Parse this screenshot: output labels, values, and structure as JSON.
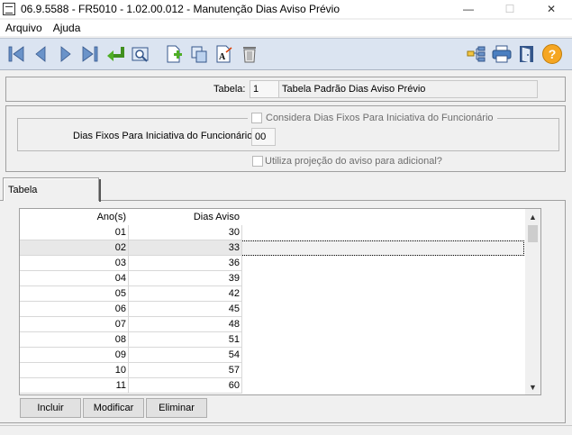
{
  "window": {
    "title": "06.9.5588 - FR5010 - 1.02.00.012 - Manutenção Dias Aviso Prévio",
    "minimize_glyph": "—",
    "maximize_glyph": "☐",
    "close_glyph": "✕"
  },
  "menu": {
    "items": [
      "Arquivo",
      "Ajuda"
    ]
  },
  "toolbar": {
    "icons": [
      "first-record-icon",
      "previous-record-icon",
      "next-record-icon",
      "last-record-icon",
      "return-icon",
      "preview-icon",
      "new-document-icon",
      "copy-icon",
      "edit-text-icon",
      "delete-icon",
      "structure-icon",
      "print-icon",
      "exit-icon",
      "help-icon"
    ],
    "help_glyph": "?",
    "accent_color": "#1e88e5"
  },
  "header": {
    "tabela_label": "Tabela:",
    "tabela_code": "1",
    "tabela_desc": "Tabela Padrão Dias Aviso Prévio"
  },
  "options": {
    "considera_label": "Considera Dias Fixos Para Iniciativa do Funcionário",
    "dias_fixos_label": "Dias Fixos Para Iniciativa do Funcionário:",
    "dias_fixos_value": "00",
    "projecao_label": "Utiliza projeção do aviso para adicional?"
  },
  "tab": {
    "label": "Tabela"
  },
  "grid": {
    "columns": [
      "Ano(s)",
      "Dias Aviso"
    ],
    "rows": [
      [
        "01",
        "30"
      ],
      [
        "02",
        "33"
      ],
      [
        "03",
        "36"
      ],
      [
        "04",
        "39"
      ],
      [
        "05",
        "42"
      ],
      [
        "06",
        "45"
      ],
      [
        "07",
        "48"
      ],
      [
        "08",
        "51"
      ],
      [
        "09",
        "54"
      ],
      [
        "10",
        "57"
      ],
      [
        "11",
        "60"
      ]
    ],
    "selected_row": 1
  },
  "actions": {
    "incluir": "Incluir",
    "modificar": "Modificar",
    "eliminar": "Eliminar"
  }
}
